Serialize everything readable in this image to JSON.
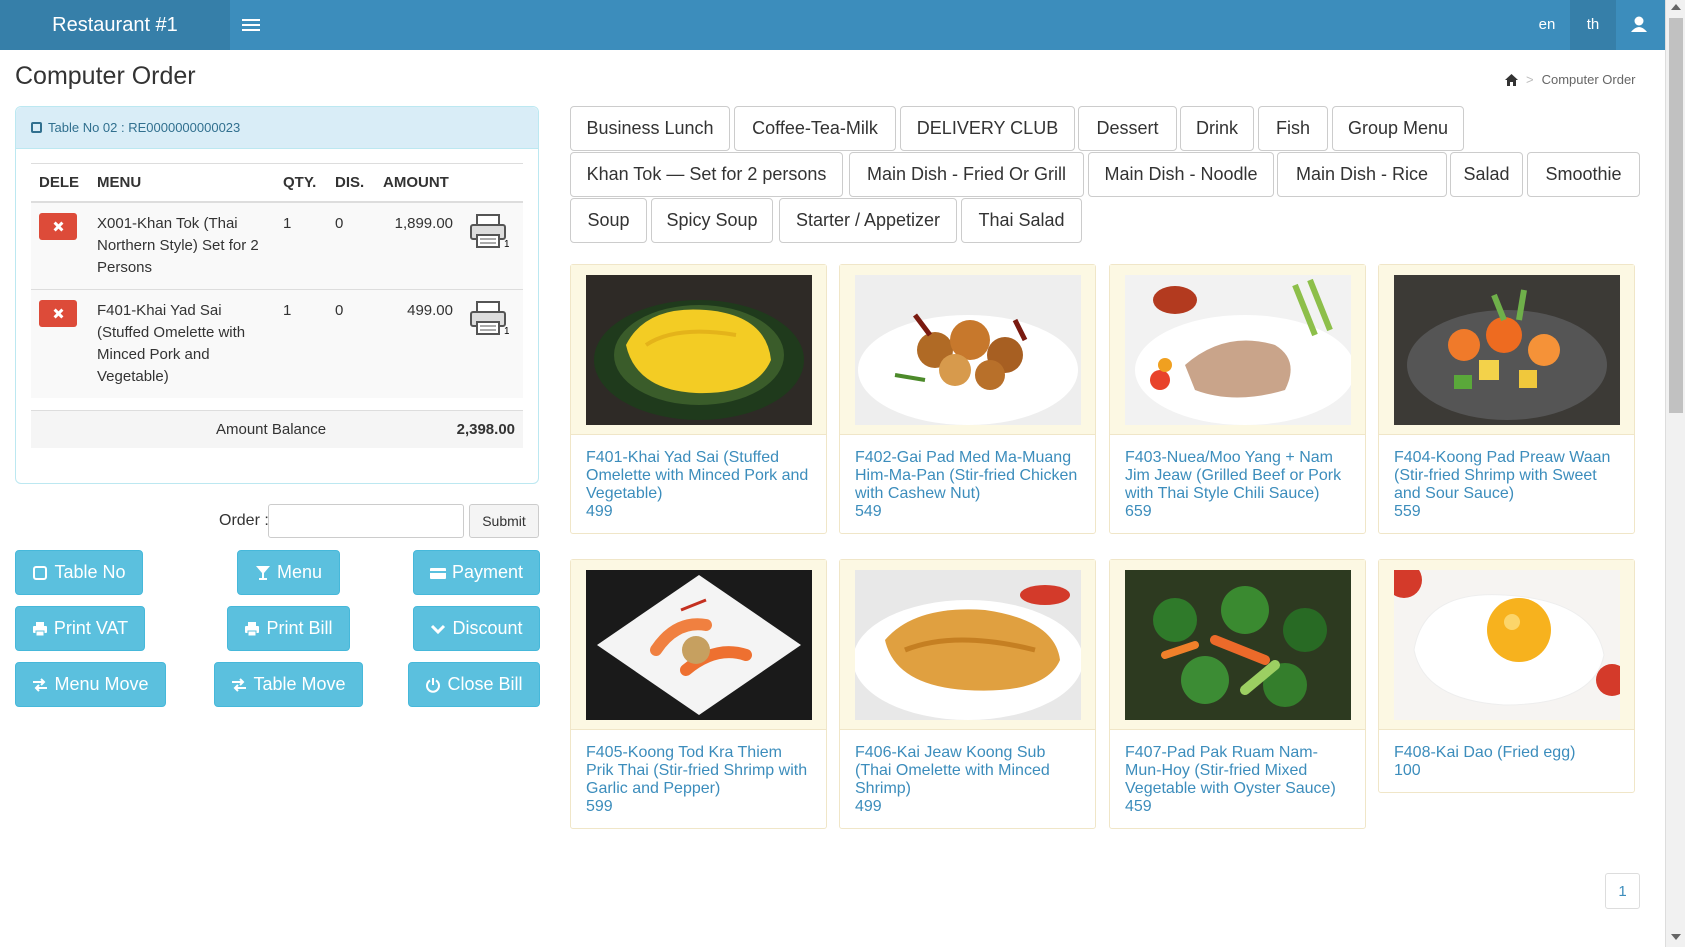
{
  "header": {
    "brand": "Restaurant #1",
    "languages": [
      "en",
      "th"
    ],
    "accent_color": "#3c8dbc",
    "icons": [
      "hamburger-icon",
      "user-icon"
    ]
  },
  "page": {
    "title": "Computer Order",
    "breadcrumb": [
      "home-icon",
      "Computer Order"
    ]
  },
  "order": {
    "table_label": "Table No 02 : RE0000000000023",
    "columns": [
      "DELE",
      "MENU",
      "QTY.",
      "DIS.",
      "AMOUNT"
    ],
    "items": [
      {
        "menu": "X001-Khan Tok (Thai Northern Style) Set for 2 Persons",
        "qty": "1",
        "dis": "0",
        "amount": "1,899.00"
      },
      {
        "menu": "F401-Khai Yad Sai (Stuffed Omelette with Minced Pork and Vegetable)",
        "qty": "1",
        "dis": "0",
        "amount": "499.00"
      }
    ],
    "balance_label": "Amount Balance",
    "balance_value": "2,398.00",
    "input_label": "Order :",
    "input_value": "",
    "submit_label": "Submit"
  },
  "actions": {
    "table_no": "Table No",
    "menu": "Menu",
    "payment": "Payment",
    "print_vat": "Print VAT",
    "print_bill": "Print Bill",
    "discount": "Discount",
    "menu_move": "Menu Move",
    "table_move": "Table Move",
    "close_bill": "Close Bill"
  },
  "categories": [
    "Business Lunch",
    "Coffee-Tea-Milk",
    "DELIVERY CLUB",
    "Dessert",
    "Drink",
    "Fish",
    "Group Menu",
    "Khan Tok — Set for 2 persons",
    "Main Dish - Fried Or Grill",
    "Main Dish - Noodle",
    "Main Dish - Rice",
    "Salad",
    "Smoothie",
    "Soup",
    "Spicy Soup",
    "Starter / Appetizer",
    "Thai Salad"
  ],
  "products": [
    {
      "name": "F401-Khai Yad Sai (Stuffed Omelette with Minced Pork and Vegetable)",
      "price": "499"
    },
    {
      "name": "F402-Gai Pad Med Ma-Muang Him-Ma-Pan (Stir-fried Chicken with Cashew Nut)",
      "price": "549"
    },
    {
      "name": "F403-Nuea/Moo Yang + Nam Jim Jeaw (Grilled Beef or Pork with Thai Style Chili Sauce)",
      "price": "659"
    },
    {
      "name": "F404-Koong Pad Preaw Waan (Stir-fried Shrimp with Sweet and Sour Sauce)",
      "price": "559"
    },
    {
      "name": "F405-Koong Tod Kra Thiem Prik Thai (Stir-fried Shrimp with Garlic and Pepper)",
      "price": "599"
    },
    {
      "name": "F406-Kai Jeaw Koong Sub (Thai Omelette with Minced Shrimp)",
      "price": "499"
    },
    {
      "name": "F407-Pad Pak Ruam Nam-Mun-Hoy (Stir-fried Mixed Vegetable with Oyster Sauce)",
      "price": "459"
    },
    {
      "name": "F408-Kai Dao (Fried egg)",
      "price": "100"
    }
  ],
  "pagination": {
    "current": "1"
  }
}
